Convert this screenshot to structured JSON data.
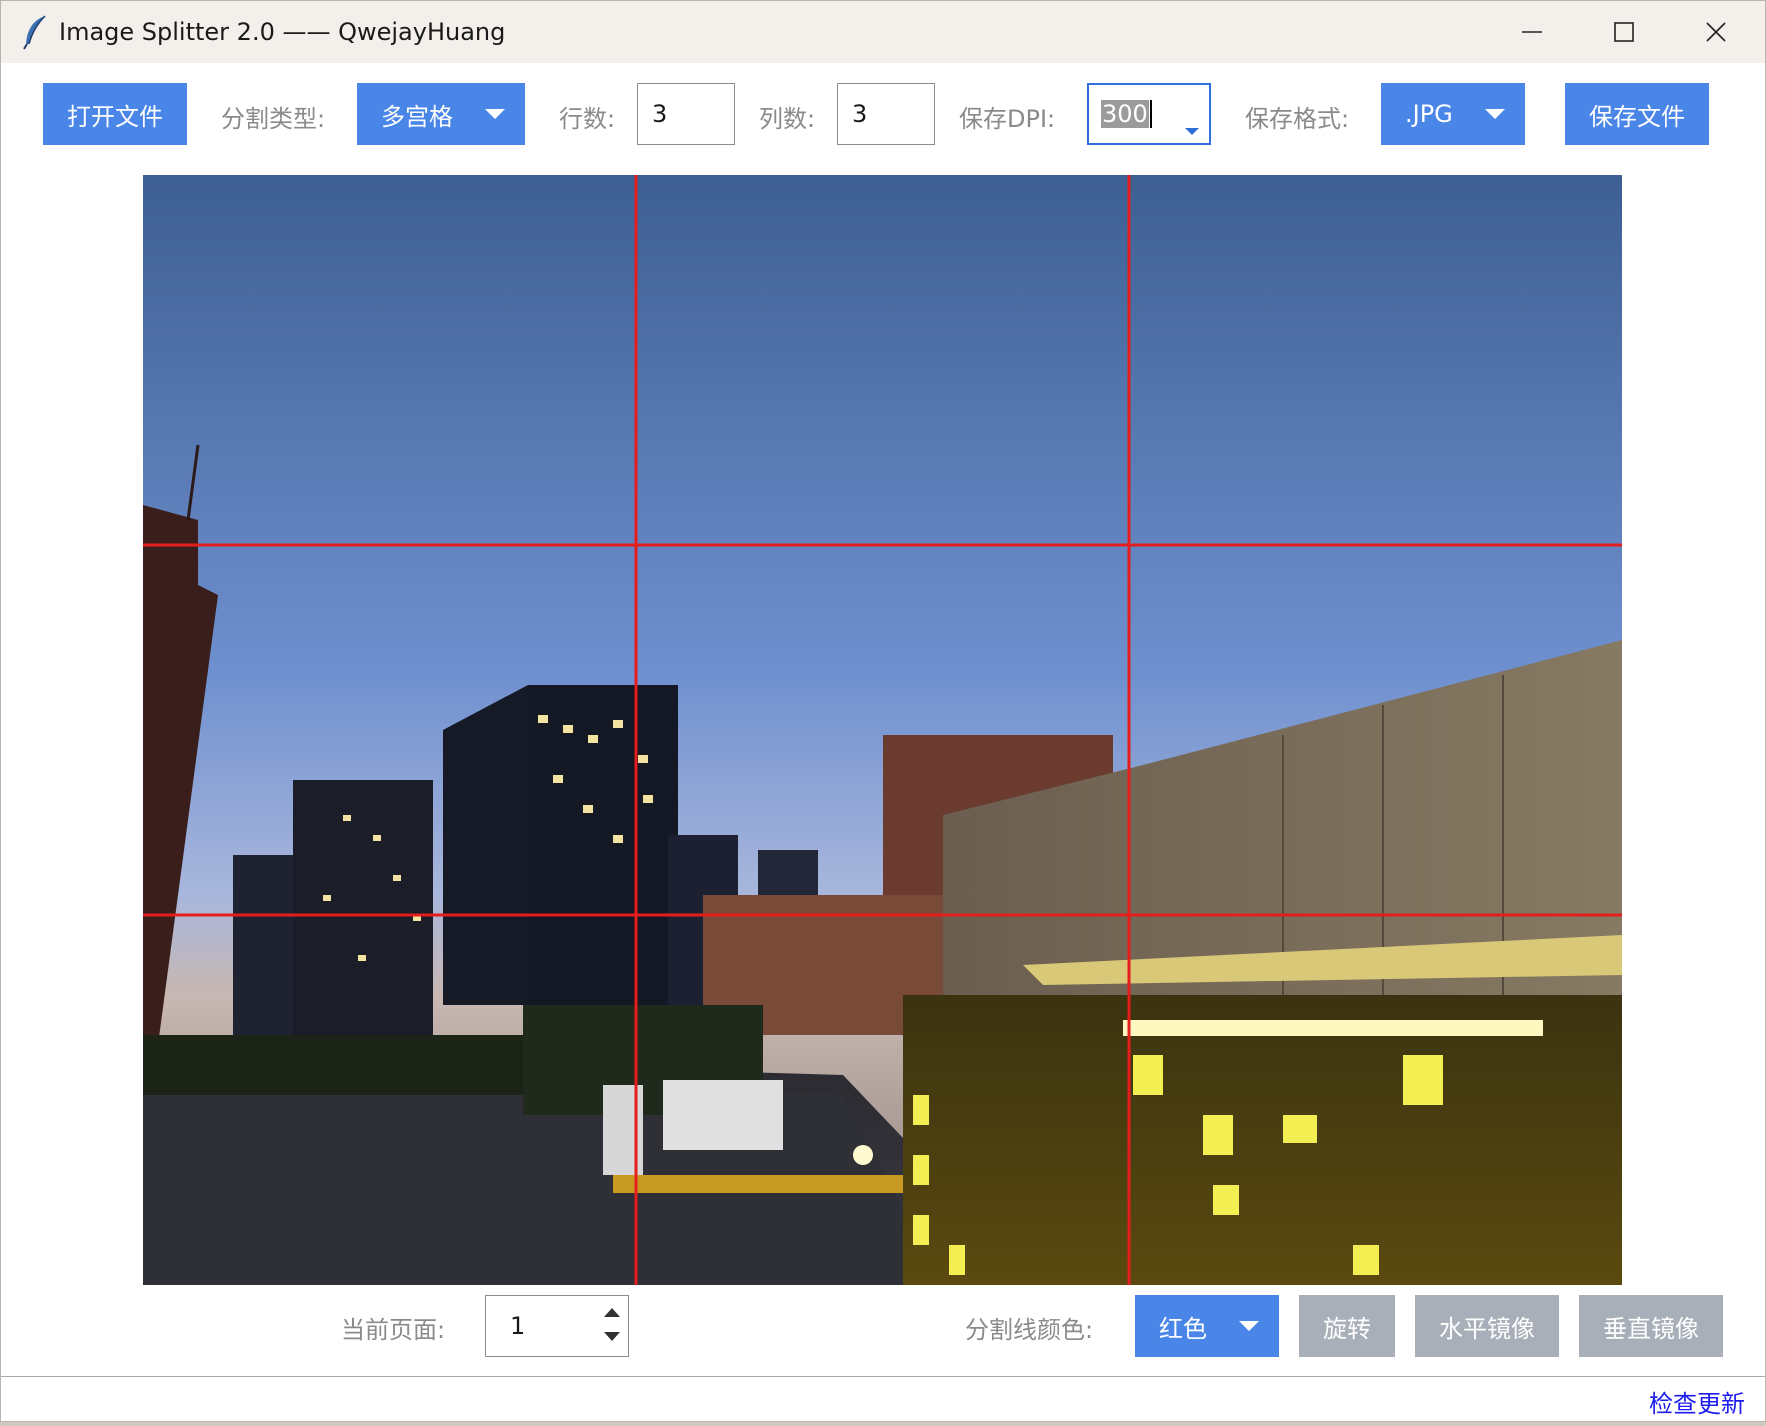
{
  "window": {
    "title": "Image Splitter 2.0 —— QwejayHuang"
  },
  "toolbar": {
    "open_file": "打开文件",
    "split_type_label": "分割类型:",
    "split_type_value": "多宫格",
    "rows_label": "行数:",
    "rows_value": "3",
    "cols_label": "列数:",
    "cols_value": "3",
    "dpi_label": "保存DPI:",
    "dpi_value": "300",
    "format_label": "保存格式:",
    "format_value": ".JPG",
    "save_file": "保存文件"
  },
  "preview": {
    "grid_rows": 3,
    "grid_cols": 3,
    "line_color": "#e51d1d"
  },
  "bottom": {
    "page_label": "当前页面:",
    "page_value": "1",
    "line_color_label": "分割线颜色:",
    "line_color_value": "红色",
    "rotate": "旋转",
    "h_mirror": "水平镜像",
    "v_mirror": "垂直镜像"
  },
  "status": {
    "check_update": "检查更新"
  },
  "colors": {
    "accent": "#4a86e8",
    "disabled_button": "#a8afb9",
    "link": "#1c1cf0"
  }
}
